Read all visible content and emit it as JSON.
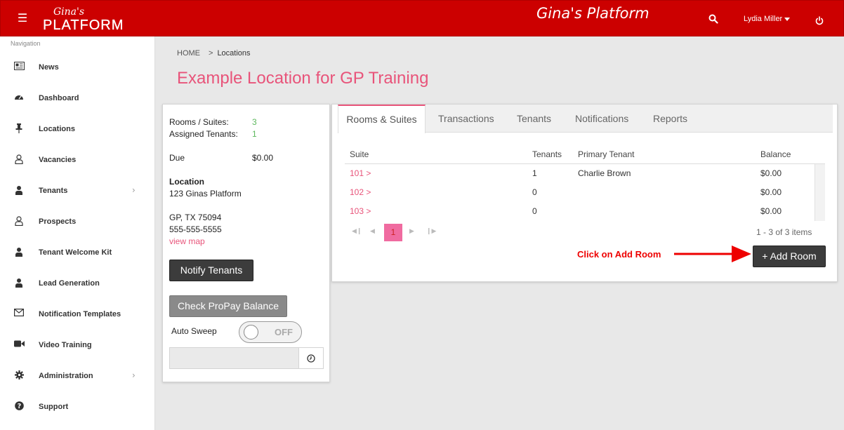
{
  "header": {
    "logo_script": "Gina's",
    "logo_word": "PLATFORM",
    "title": "Gina's Platform",
    "user_name": "Lydia Miller",
    "colors": {
      "bar": "#cc0000",
      "accent": "#e8547a"
    }
  },
  "sidebar": {
    "caption": "Navigation",
    "items": [
      {
        "label": "News",
        "icon": "newspaper-icon"
      },
      {
        "label": "Dashboard",
        "icon": "gauge-icon"
      },
      {
        "label": "Locations",
        "icon": "pin-icon"
      },
      {
        "label": "Vacancies",
        "icon": "user-outline-icon"
      },
      {
        "label": "Tenants",
        "icon": "user-icon",
        "has_children": true
      },
      {
        "label": "Prospects",
        "icon": "user-outline-icon"
      },
      {
        "label": "Tenant Welcome Kit",
        "icon": "user-icon"
      },
      {
        "label": "Lead Generation",
        "icon": "user-icon"
      },
      {
        "label": "Notification Templates",
        "icon": "envelope-icon"
      },
      {
        "label": "Video Training",
        "icon": "video-camera-icon"
      },
      {
        "label": "Administration",
        "icon": "gear-icon",
        "has_children": true
      },
      {
        "label": "Support",
        "icon": "question-circle-icon"
      }
    ]
  },
  "breadcrumb": {
    "home": "HOME",
    "sep": ">",
    "current": "Locations"
  },
  "page_title": "Example Location for GP Training",
  "summary": {
    "rooms_label": "Rooms / Suites:",
    "rooms_value": "3",
    "tenants_label": "Assigned Tenants:",
    "tenants_value": "1",
    "due_label": "Due",
    "due_value": "$0.00",
    "location_heading": "Location",
    "address_line1": "123 Ginas Platform",
    "address_line2": "GP, TX 75094",
    "phone": "555-555-5555",
    "map_link": "view map",
    "notify_button": "Notify Tenants",
    "propay_button": "Check ProPay Balance",
    "auto_sweep_label": "Auto Sweep",
    "auto_sweep_state": "OFF"
  },
  "tabs": [
    {
      "label": "Rooms & Suites",
      "active": true
    },
    {
      "label": "Transactions"
    },
    {
      "label": "Tenants"
    },
    {
      "label": "Notifications"
    },
    {
      "label": "Reports"
    }
  ],
  "table": {
    "columns": [
      "Suite",
      "Tenants",
      "Primary Tenant",
      "Balance"
    ],
    "rows": [
      {
        "suite": "101 >",
        "tenants": "1",
        "primary": "Charlie Brown",
        "balance": "$0.00"
      },
      {
        "suite": "102 >",
        "tenants": "0",
        "primary": "",
        "balance": "$0.00"
      },
      {
        "suite": "103 >",
        "tenants": "0",
        "primary": "",
        "balance": "$0.00"
      }
    ],
    "current_page": "1",
    "items_info": "1 - 3 of 3 items"
  },
  "add_room_button": "+ Add Room",
  "annotation": "Click on Add Room"
}
